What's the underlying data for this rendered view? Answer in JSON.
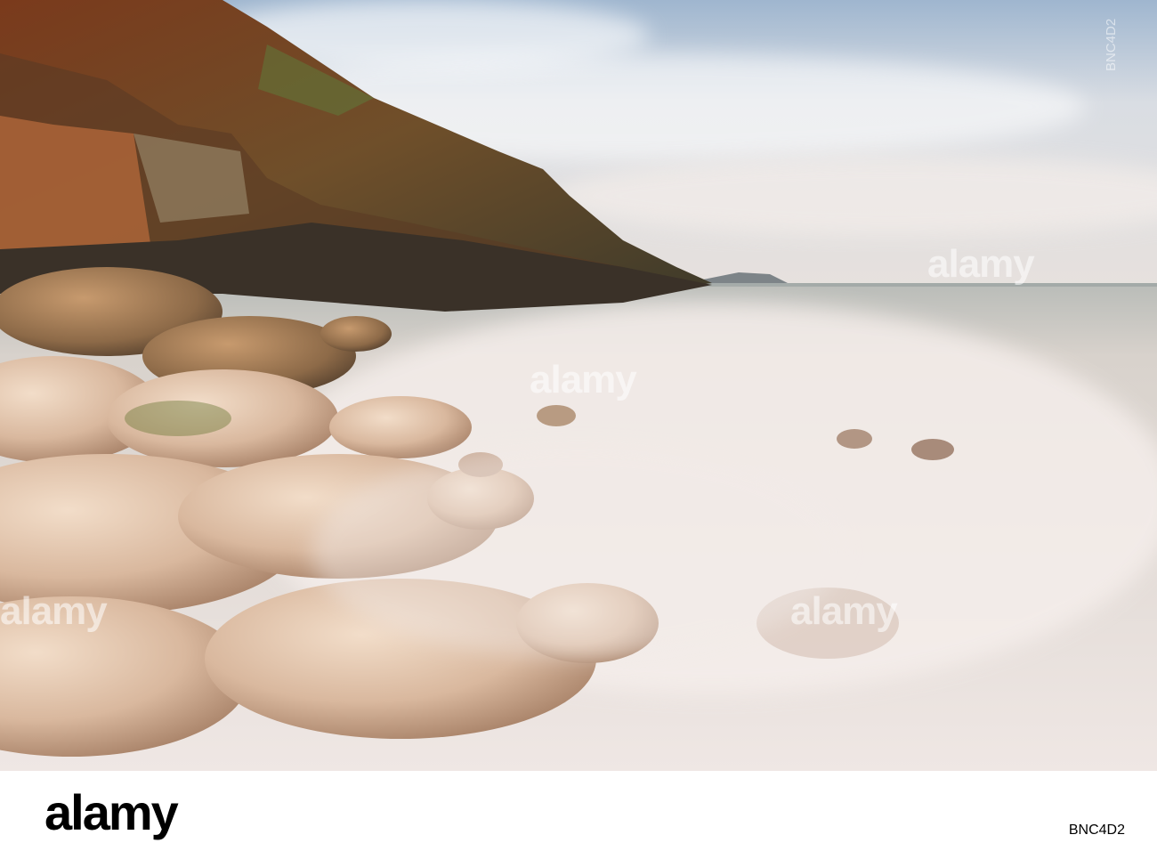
{
  "watermark": {
    "brand": "alamy",
    "image_id": "BNC4D2"
  },
  "footer": {
    "brand": "alamy",
    "image_id": "BNC4D2"
  }
}
